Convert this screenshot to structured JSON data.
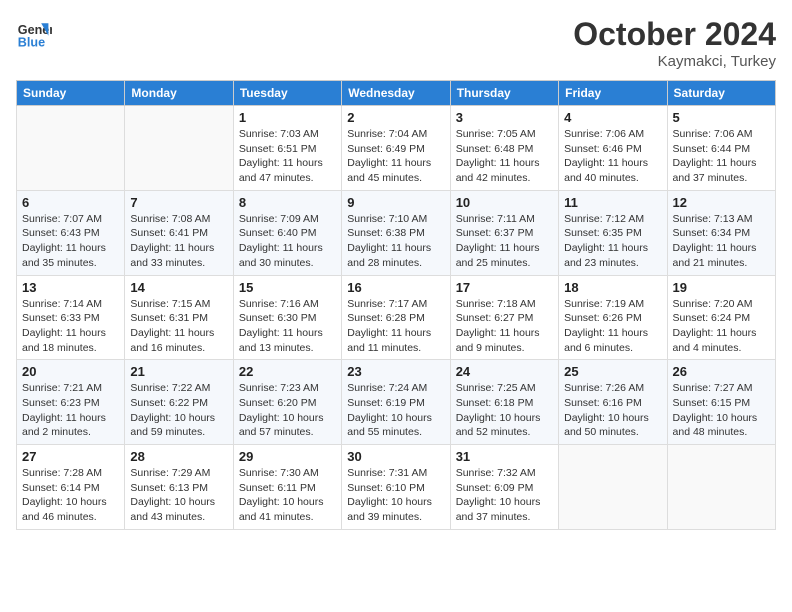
{
  "header": {
    "logo_line1": "General",
    "logo_line2": "Blue",
    "month": "October 2024",
    "location": "Kaymakci, Turkey"
  },
  "weekdays": [
    "Sunday",
    "Monday",
    "Tuesday",
    "Wednesday",
    "Thursday",
    "Friday",
    "Saturday"
  ],
  "weeks": [
    [
      {
        "day": "",
        "info": ""
      },
      {
        "day": "",
        "info": ""
      },
      {
        "day": "1",
        "info": "Sunrise: 7:03 AM\nSunset: 6:51 PM\nDaylight: 11 hours and 47 minutes."
      },
      {
        "day": "2",
        "info": "Sunrise: 7:04 AM\nSunset: 6:49 PM\nDaylight: 11 hours and 45 minutes."
      },
      {
        "day": "3",
        "info": "Sunrise: 7:05 AM\nSunset: 6:48 PM\nDaylight: 11 hours and 42 minutes."
      },
      {
        "day": "4",
        "info": "Sunrise: 7:06 AM\nSunset: 6:46 PM\nDaylight: 11 hours and 40 minutes."
      },
      {
        "day": "5",
        "info": "Sunrise: 7:06 AM\nSunset: 6:44 PM\nDaylight: 11 hours and 37 minutes."
      }
    ],
    [
      {
        "day": "6",
        "info": "Sunrise: 7:07 AM\nSunset: 6:43 PM\nDaylight: 11 hours and 35 minutes."
      },
      {
        "day": "7",
        "info": "Sunrise: 7:08 AM\nSunset: 6:41 PM\nDaylight: 11 hours and 33 minutes."
      },
      {
        "day": "8",
        "info": "Sunrise: 7:09 AM\nSunset: 6:40 PM\nDaylight: 11 hours and 30 minutes."
      },
      {
        "day": "9",
        "info": "Sunrise: 7:10 AM\nSunset: 6:38 PM\nDaylight: 11 hours and 28 minutes."
      },
      {
        "day": "10",
        "info": "Sunrise: 7:11 AM\nSunset: 6:37 PM\nDaylight: 11 hours and 25 minutes."
      },
      {
        "day": "11",
        "info": "Sunrise: 7:12 AM\nSunset: 6:35 PM\nDaylight: 11 hours and 23 minutes."
      },
      {
        "day": "12",
        "info": "Sunrise: 7:13 AM\nSunset: 6:34 PM\nDaylight: 11 hours and 21 minutes."
      }
    ],
    [
      {
        "day": "13",
        "info": "Sunrise: 7:14 AM\nSunset: 6:33 PM\nDaylight: 11 hours and 18 minutes."
      },
      {
        "day": "14",
        "info": "Sunrise: 7:15 AM\nSunset: 6:31 PM\nDaylight: 11 hours and 16 minutes."
      },
      {
        "day": "15",
        "info": "Sunrise: 7:16 AM\nSunset: 6:30 PM\nDaylight: 11 hours and 13 minutes."
      },
      {
        "day": "16",
        "info": "Sunrise: 7:17 AM\nSunset: 6:28 PM\nDaylight: 11 hours and 11 minutes."
      },
      {
        "day": "17",
        "info": "Sunrise: 7:18 AM\nSunset: 6:27 PM\nDaylight: 11 hours and 9 minutes."
      },
      {
        "day": "18",
        "info": "Sunrise: 7:19 AM\nSunset: 6:26 PM\nDaylight: 11 hours and 6 minutes."
      },
      {
        "day": "19",
        "info": "Sunrise: 7:20 AM\nSunset: 6:24 PM\nDaylight: 11 hours and 4 minutes."
      }
    ],
    [
      {
        "day": "20",
        "info": "Sunrise: 7:21 AM\nSunset: 6:23 PM\nDaylight: 11 hours and 2 minutes."
      },
      {
        "day": "21",
        "info": "Sunrise: 7:22 AM\nSunset: 6:22 PM\nDaylight: 10 hours and 59 minutes."
      },
      {
        "day": "22",
        "info": "Sunrise: 7:23 AM\nSunset: 6:20 PM\nDaylight: 10 hours and 57 minutes."
      },
      {
        "day": "23",
        "info": "Sunrise: 7:24 AM\nSunset: 6:19 PM\nDaylight: 10 hours and 55 minutes."
      },
      {
        "day": "24",
        "info": "Sunrise: 7:25 AM\nSunset: 6:18 PM\nDaylight: 10 hours and 52 minutes."
      },
      {
        "day": "25",
        "info": "Sunrise: 7:26 AM\nSunset: 6:16 PM\nDaylight: 10 hours and 50 minutes."
      },
      {
        "day": "26",
        "info": "Sunrise: 7:27 AM\nSunset: 6:15 PM\nDaylight: 10 hours and 48 minutes."
      }
    ],
    [
      {
        "day": "27",
        "info": "Sunrise: 7:28 AM\nSunset: 6:14 PM\nDaylight: 10 hours and 46 minutes."
      },
      {
        "day": "28",
        "info": "Sunrise: 7:29 AM\nSunset: 6:13 PM\nDaylight: 10 hours and 43 minutes."
      },
      {
        "day": "29",
        "info": "Sunrise: 7:30 AM\nSunset: 6:11 PM\nDaylight: 10 hours and 41 minutes."
      },
      {
        "day": "30",
        "info": "Sunrise: 7:31 AM\nSunset: 6:10 PM\nDaylight: 10 hours and 39 minutes."
      },
      {
        "day": "31",
        "info": "Sunrise: 7:32 AM\nSunset: 6:09 PM\nDaylight: 10 hours and 37 minutes."
      },
      {
        "day": "",
        "info": ""
      },
      {
        "day": "",
        "info": ""
      }
    ]
  ]
}
